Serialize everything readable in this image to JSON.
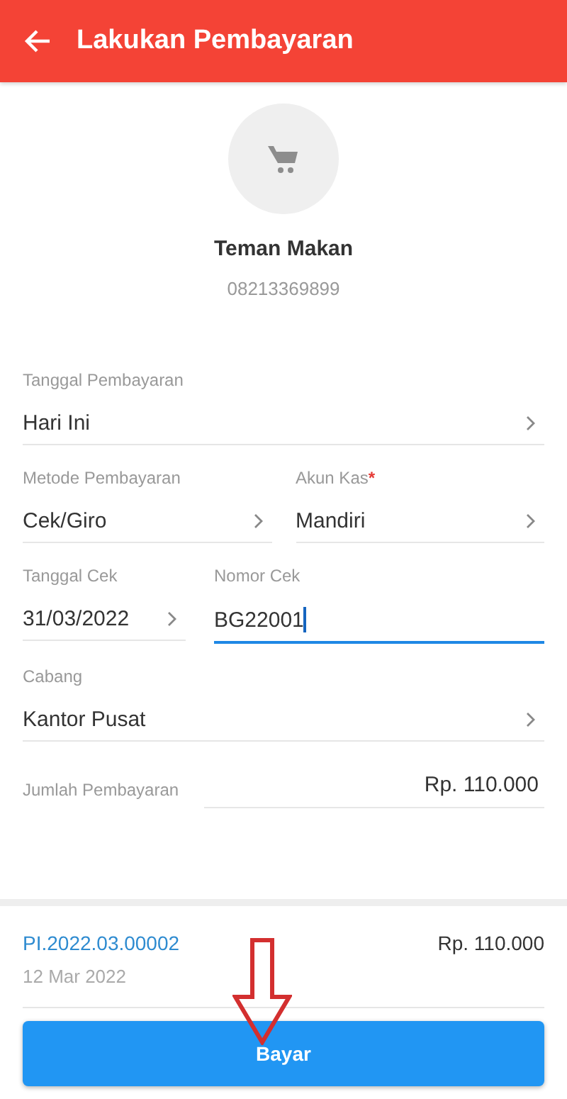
{
  "header": {
    "title": "Lakukan Pembayaran"
  },
  "customer": {
    "name": "Teman Makan",
    "phone": "08213369899"
  },
  "form": {
    "payment_date": {
      "label": "Tanggal Pembayaran",
      "value": "Hari Ini"
    },
    "payment_method": {
      "label": "Metode Pembayaran",
      "value": "Cek/Giro"
    },
    "cash_account": {
      "label": "Akun Kas",
      "required_mark": "*",
      "value": "Mandiri"
    },
    "check_date": {
      "label": "Tanggal Cek",
      "value": "31/03/2022"
    },
    "check_number": {
      "label": "Nomor Cek",
      "value": "BG22001",
      "focused": true
    },
    "branch": {
      "label": "Cabang",
      "value": "Kantor Pusat"
    },
    "amount": {
      "label": "Jumlah Pembayaran",
      "value": "Rp. 110.000"
    }
  },
  "invoice": {
    "number": "PI.2022.03.00002",
    "date": "12 Mar 2022",
    "amount": "Rp. 110.000"
  },
  "pay_button": {
    "label": "Bayar"
  }
}
